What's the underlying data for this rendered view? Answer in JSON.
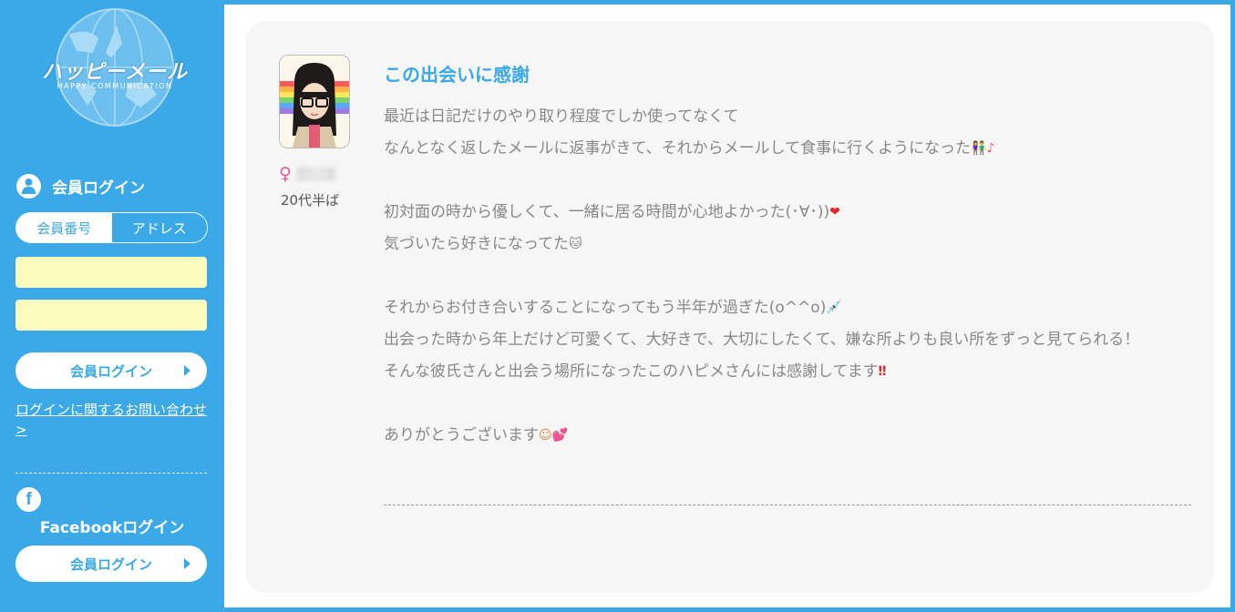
{
  "brand": {
    "logo_text": "ハッピーメール",
    "logo_sub": "HAPPY COMMUNICATION"
  },
  "login": {
    "title": "会員ログイン",
    "tabs": [
      {
        "label": "会員番号",
        "active": true
      },
      {
        "label": "アドレス",
        "active": false
      }
    ],
    "field1_value": "",
    "field2_value": "",
    "button_label": "会員ログイン",
    "help_link": "ログインに関するお問い合わせ >"
  },
  "facebook": {
    "icon_letter": "f",
    "title": "Facebookログイン",
    "button_label": "会員ログイン"
  },
  "post": {
    "user_gender_symbol": "♀",
    "user_age": "20代半ば",
    "title": "この出会いに感謝",
    "lines": {
      "l1": "最近は日記だけのやり取り程度でしか使ってなくて",
      "l2": "なんとなく返したメールに返事がきて、それからメールして食事に行くようになった",
      "l3": "初対面の時から優しくて、一緒に居る時間が心地よかった(･∀･))",
      "l4": "気づいたら好きになってた",
      "l5": "それからお付き合いすることになってもう半年が過ぎた(o^^o)",
      "l6": "出会った時から年上だけど可愛くて、大好きで、大切にしたくて、嫌な所よりも良い所をずっと見てられる！",
      "l7": "そんな彼氏さんと出会う場所になったこのハピメさんには感謝してます",
      "l8": "ありがとうございます"
    },
    "emoji": {
      "couple": "👫",
      "music": "♪",
      "heart": "❤",
      "cat": "🐱",
      "syringe": "💉",
      "exclaim": "‼",
      "smile": "☺",
      "hearts": "💕"
    }
  },
  "colors": {
    "brand_blue": "#3ba8e8",
    "input_yellow": "#fcfcbf",
    "title_blue": "#3ba8e8",
    "female_pink": "#e8578f"
  }
}
